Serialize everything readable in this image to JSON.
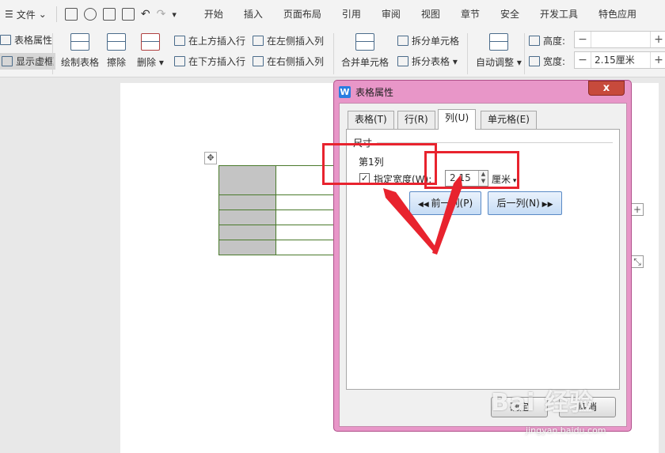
{
  "menubar": {
    "file_label": "文件",
    "tabs": [
      "开始",
      "插入",
      "页面布局",
      "引用",
      "审阅",
      "视图",
      "章节",
      "安全",
      "开发工具",
      "特色应用"
    ]
  },
  "ribbon": {
    "table_props": "表格属性",
    "show_gridlines": "显示虚框",
    "draw_table": "绘制表格",
    "eraser": "擦除",
    "delete": "删除",
    "insert_above": "在上方插入行",
    "insert_below": "在下方插入行",
    "insert_left": "在左侧插入列",
    "insert_right": "在右侧插入列",
    "merge_cells": "合并单元格",
    "split_cells": "拆分单元格",
    "split_table": "拆分表格",
    "auto_fit": "自动调整",
    "height_label": "高度:",
    "height_value": "",
    "width_label": "宽度:",
    "width_value": "2.15厘米"
  },
  "dialog": {
    "title": "表格属性",
    "close": "x",
    "tabs": [
      "表格(T)",
      "行(R)",
      "列(U)",
      "单元格(E)"
    ],
    "active_tab": "列(U)",
    "group_title": "尺寸",
    "column_name": "第1列",
    "specify_width_label": "指定宽度(W):",
    "specify_width_checked": true,
    "width_value": "2.15",
    "unit": "厘米",
    "prev_column": "前一列(P)",
    "next_column": "后一列(N)",
    "ok": "确定",
    "cancel": "取消"
  },
  "watermark": {
    "brand": "Bai 经验",
    "url": "jingyan.baidu.com"
  }
}
